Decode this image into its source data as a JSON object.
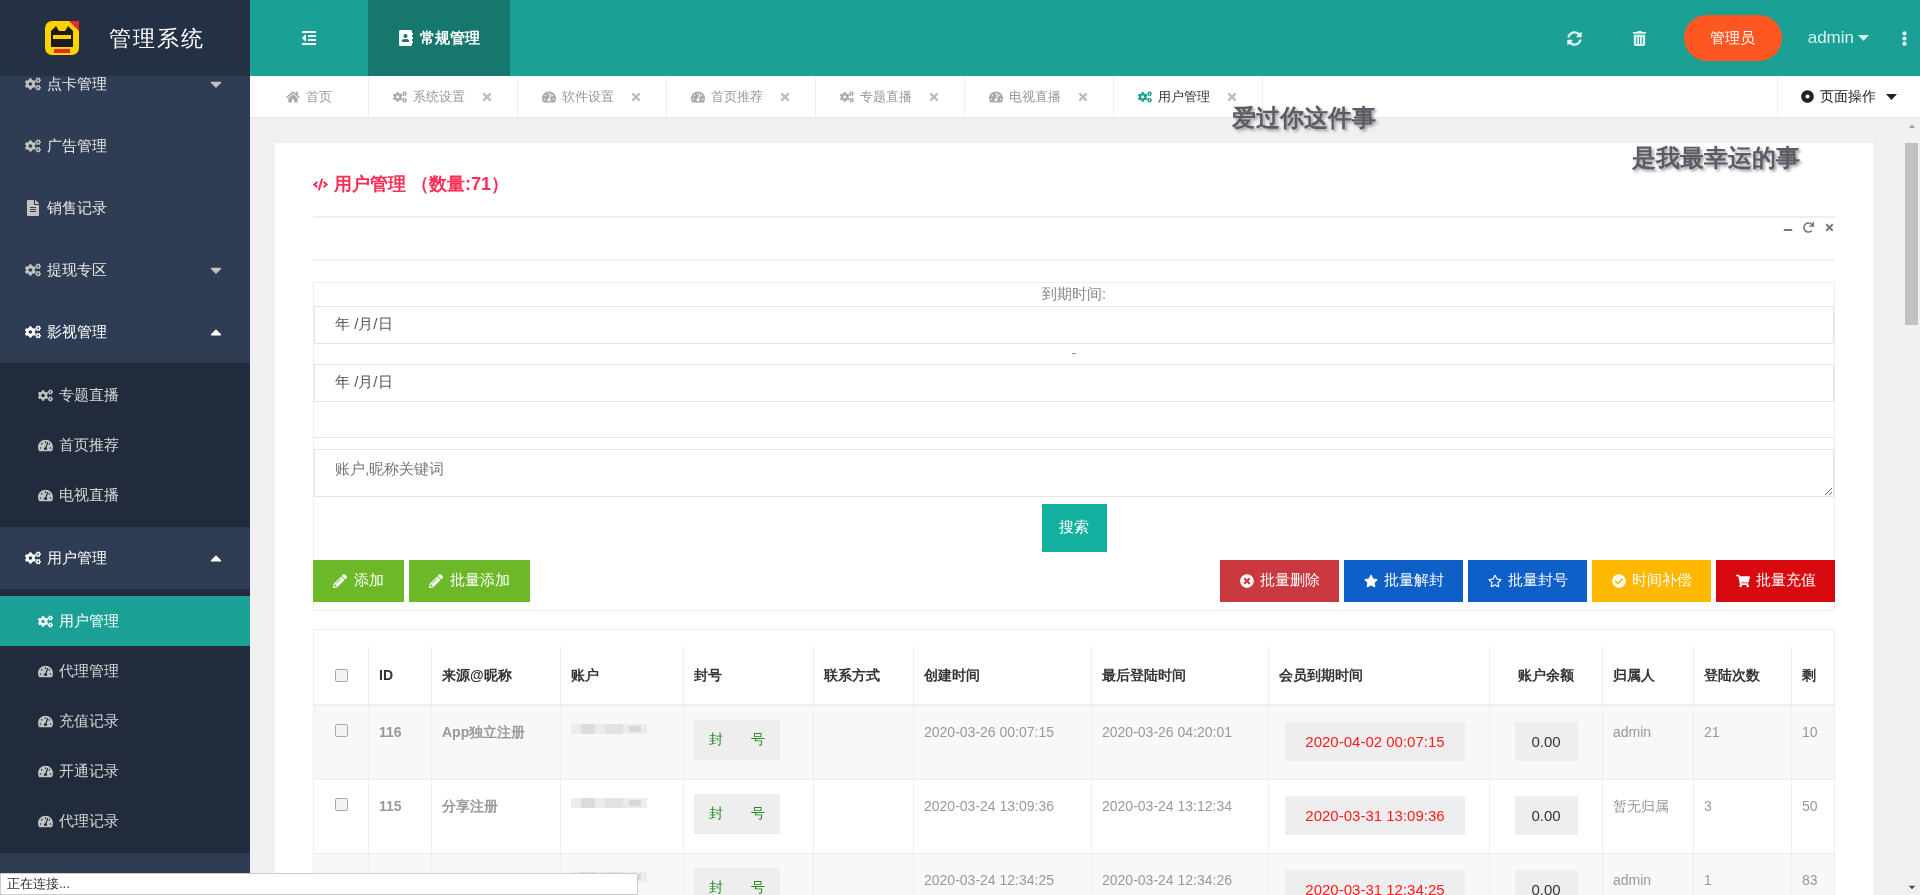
{
  "header": {
    "title": "管理系统",
    "nav": [
      {
        "label": "常规管理",
        "selected": true
      }
    ],
    "role_button": "管理员",
    "user": "admin"
  },
  "sidebar": {
    "items": [
      {
        "label": "点卡管理",
        "kind": "gear",
        "expanded": false
      },
      {
        "label": "广告管理",
        "kind": "gear"
      },
      {
        "label": "销售记录",
        "kind": "document"
      },
      {
        "label": "提现专区",
        "kind": "gear",
        "expanded": false
      },
      {
        "label": "影视管理",
        "kind": "gear",
        "expanded": true,
        "children": [
          {
            "label": "专题直播",
            "kind": "gear",
            "selected": false
          },
          {
            "label": "首页推荐",
            "kind": "gauge",
            "selected": false
          },
          {
            "label": "电视直播",
            "kind": "gauge",
            "selected": false
          }
        ]
      },
      {
        "label": "用户管理",
        "kind": "gear",
        "expanded": true,
        "children": [
          {
            "label": "用户管理",
            "kind": "gear",
            "selected": true
          },
          {
            "label": "代理管理",
            "kind": "gauge",
            "selected": false
          },
          {
            "label": "充值记录",
            "kind": "gauge",
            "selected": false
          },
          {
            "label": "开通记录",
            "kind": "gauge",
            "selected": false
          },
          {
            "label": "代理记录",
            "kind": "gauge",
            "selected": false
          }
        ]
      }
    ]
  },
  "tabs": [
    {
      "label": "首页",
      "kind": "home",
      "selected": false
    },
    {
      "label": "系统设置",
      "kind": "gear",
      "selected": false
    },
    {
      "label": "软件设置",
      "kind": "gauge",
      "selected": false
    },
    {
      "label": "首页推荐",
      "kind": "gauge",
      "selected": false
    },
    {
      "label": "专题直播",
      "kind": "gear",
      "selected": false
    },
    {
      "label": "电视直播",
      "kind": "gauge",
      "selected": false
    },
    {
      "label": "用户管理",
      "kind": "gear",
      "selected": true
    }
  ],
  "page_actions": "页面操作",
  "floating_texts": [
    "爱过你这件事",
    "是我最幸运的事"
  ],
  "card": {
    "title": "用户管理 （数量:71）",
    "filter": {
      "label": "到期时间:",
      "date_from": "年 /月/日",
      "separator": "-",
      "date_to": "年 /月/日",
      "keyword_placeholder": "账户,昵称关键词",
      "search_button": "搜索"
    },
    "left_actions": [
      {
        "label": "添加",
        "kind": "pencil"
      },
      {
        "label": "批量添加",
        "kind": "pencil"
      }
    ],
    "right_actions": [
      {
        "label": "批量删除",
        "kind": "times-circle",
        "color": "#c9393f"
      },
      {
        "label": "批量解封",
        "kind": "star",
        "color": "#0e5fc7"
      },
      {
        "label": "批量封号",
        "kind": "star-outline",
        "color": "#0e5fc7"
      },
      {
        "label": "时间补偿",
        "kind": "check-circle",
        "color": "#ffb800"
      },
      {
        "label": "批量充值",
        "kind": "cart",
        "color": "#d80a10"
      }
    ],
    "table": {
      "all_checked": false,
      "columns": [
        "ID",
        "来源@昵称",
        "账户",
        "封号",
        "联系方式",
        "创建时间",
        "最后登陆时间",
        "会员到期时间",
        "账户余额",
        "归属人",
        "登陆次数",
        "剩"
      ],
      "rows": [
        {
          "checked": false,
          "id": "116",
          "source": "App独立注册",
          "ban_button": "封 号",
          "created": "2020-03-26 00:07:15",
          "last_login": "2020-03-26 04:20:01",
          "expiry": "2020-04-02 00:07:15",
          "balance": "0.00",
          "owner": "admin",
          "logins": "21",
          "remaining": "10"
        },
        {
          "checked": false,
          "id": "115",
          "source": "分享注册",
          "ban_button": "封 号",
          "created": "2020-03-24 13:09:36",
          "last_login": "2020-03-24 13:12:34",
          "expiry": "2020-03-31 13:09:36",
          "balance": "0.00",
          "owner": "暂无归属",
          "logins": "3",
          "remaining": "50"
        },
        {
          "ban_button": "封 号",
          "created": "2020-03-24 12:34:25",
          "last_login": "2020-03-24 12:34:26",
          "expiry": "2020-03-31 12:34:25",
          "balance": "0.00",
          "owner": "admin",
          "logins": "1",
          "remaining": "83"
        }
      ]
    }
  },
  "status_bar": "正在连接..."
}
